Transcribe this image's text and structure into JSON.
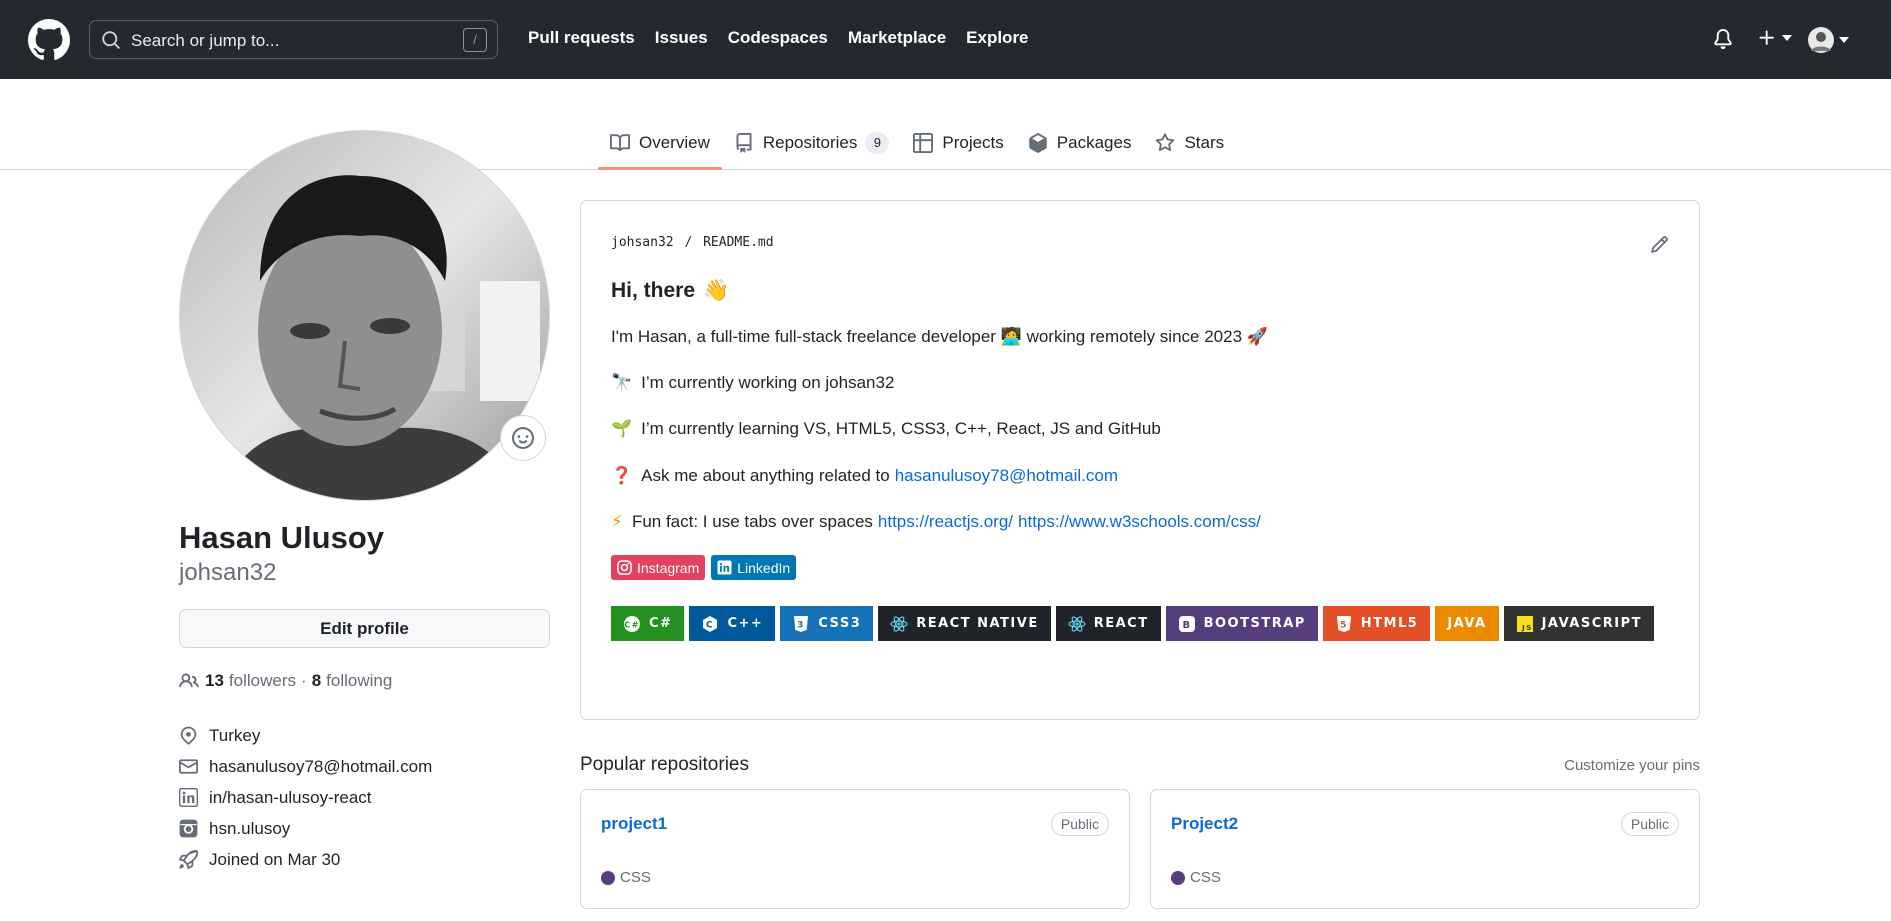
{
  "header": {
    "search_placeholder": "Search or jump to...",
    "search_shortcut": "/",
    "nav": [
      "Pull requests",
      "Issues",
      "Codespaces",
      "Marketplace",
      "Explore"
    ]
  },
  "tabs": [
    {
      "label": "Overview",
      "icon": "book-icon",
      "active": true
    },
    {
      "label": "Repositories",
      "icon": "repo-icon",
      "count": "9"
    },
    {
      "label": "Projects",
      "icon": "table-icon"
    },
    {
      "label": "Packages",
      "icon": "package-icon"
    },
    {
      "label": "Stars",
      "icon": "star-icon"
    }
  ],
  "profile": {
    "name": "Hasan Ulusoy",
    "username": "johsan32",
    "edit_button": "Edit profile",
    "followers_count": "13",
    "followers_label": "followers",
    "separator": "·",
    "following_count": "8",
    "following_label": "following",
    "location": "Turkey",
    "email": "hasanulusoy78@hotmail.com",
    "linkedin": "in/hasan-ulusoy-react",
    "instagram": "hsn.ulusoy",
    "joined": "Joined on Mar 30"
  },
  "readme": {
    "path_user": "johsan32",
    "path_sep": "/",
    "path_file": "README.md",
    "heading": "Hi, there",
    "heading_emoji": "👋",
    "line1_text": "I'm Hasan, a full-time full-stack freelance developer 🧑‍💻 working remotely since 2023 🚀",
    "line2_emoji": "🔭",
    "line2_text": "I’m currently working on johsan32",
    "line3_emoji": "🌱",
    "line3_text": "I’m currently learning VS, HTML5, CSS3, C++, React, JS and GitHub",
    "line4_emoji": "❓",
    "line4_text": "Ask me about anything related to",
    "line4_link": "hasanulusoy78@hotmail.com",
    "line5_emoji": "⚡",
    "line5_text": "Fun fact: I use tabs over spaces",
    "line5_link1": "https://reactjs.org/",
    "line5_link2": "https://www.w3schools.com/css/",
    "social_badges": [
      {
        "label": "Instagram",
        "color": "#e4405f"
      },
      {
        "label": "LinkedIn",
        "color": "#0077b5"
      }
    ],
    "tech_badges": [
      {
        "label": "C#",
        "color": "#239120",
        "icon": "C#"
      },
      {
        "label": "C++",
        "color": "#00599c",
        "icon": "C"
      },
      {
        "label": "CSS3",
        "color": "#1572b6",
        "icon": "3"
      },
      {
        "label": "REACT NATIVE",
        "color": "#20232a",
        "icon": "⚛"
      },
      {
        "label": "REACT",
        "color": "#20232a",
        "icon": "⚛"
      },
      {
        "label": "BOOTSTRAP",
        "color": "#563d7c",
        "icon": "B"
      },
      {
        "label": "HTML5",
        "color": "#e34f26",
        "icon": "5"
      },
      {
        "label": "JAVA",
        "color": "#ed8b00",
        "icon": ""
      },
      {
        "label": "JAVASCRIPT",
        "color": "#323330",
        "icon": "JS"
      }
    ]
  },
  "popular": {
    "title": "Popular repositories",
    "customize": "Customize your pins",
    "repos": [
      {
        "name": "project1",
        "visibility": "Public",
        "language": "CSS",
        "lang_color": "#563d7c"
      },
      {
        "name": "Project2",
        "visibility": "Public",
        "language": "CSS",
        "lang_color": "#563d7c"
      }
    ]
  }
}
